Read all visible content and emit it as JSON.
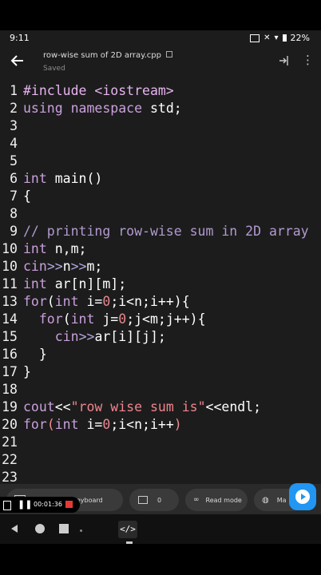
{
  "status": {
    "time": "9:11",
    "battery": "22%"
  },
  "appbar": {
    "file_name": "row-wise sum of 2D array.cpp",
    "save_state": "Saved"
  },
  "code_lines": [
    {
      "n": "1",
      "tokens": [
        [
          "kw2",
          "#include <iostream>"
        ]
      ]
    },
    {
      "n": "2",
      "tokens": [
        [
          "kw",
          "using namespace"
        ],
        [
          "plain",
          " std;"
        ]
      ]
    },
    {
      "n": "3",
      "tokens": []
    },
    {
      "n": "4",
      "tokens": []
    },
    {
      "n": "5",
      "tokens": []
    },
    {
      "n": "6",
      "tokens": [
        [
          "kw",
          "int"
        ],
        [
          "plain",
          " main()"
        ]
      ]
    },
    {
      "n": "7",
      "tokens": [
        [
          "plain",
          "{"
        ]
      ]
    },
    {
      "n": "8",
      "tokens": []
    },
    {
      "n": "9",
      "tokens": [
        [
          "cmt",
          "// printing row-wise sum in 2D array"
        ]
      ]
    },
    {
      "n": "10",
      "tokens": [
        [
          "kw",
          "int"
        ],
        [
          "plain",
          " n,m;"
        ]
      ]
    },
    {
      "n": "10",
      "tokens": [
        [
          "kw",
          "cin"
        ],
        [
          "op",
          ">>"
        ],
        [
          "plain",
          "n"
        ],
        [
          "op",
          ">>"
        ],
        [
          "plain",
          "m;"
        ]
      ]
    },
    {
      "n": "11",
      "tokens": [
        [
          "kw",
          "int"
        ],
        [
          "plain",
          " ar[n][m];"
        ]
      ]
    },
    {
      "n": "13",
      "tokens": [
        [
          "kw",
          "for"
        ],
        [
          "plain",
          "("
        ],
        [
          "kw",
          "int"
        ],
        [
          "plain",
          " i="
        ],
        [
          "num",
          "0"
        ],
        [
          "plain",
          ";i<n;i++){"
        ]
      ]
    },
    {
      "n": "14",
      "tokens": [
        [
          "plain",
          "  "
        ],
        [
          "kw",
          "for"
        ],
        [
          "plain",
          "("
        ],
        [
          "kw",
          "int"
        ],
        [
          "plain",
          " j="
        ],
        [
          "num",
          "0"
        ],
        [
          "plain",
          ";j<m;j++){"
        ]
      ]
    },
    {
      "n": "15",
      "tokens": [
        [
          "plain",
          "    "
        ],
        [
          "kw",
          "cin"
        ],
        [
          "op",
          ">>"
        ],
        [
          "plain",
          "ar[i][j];"
        ]
      ]
    },
    {
      "n": "16",
      "tokens": [
        [
          "plain",
          "  }"
        ]
      ]
    },
    {
      "n": "17",
      "tokens": [
        [
          "plain",
          "}"
        ]
      ]
    },
    {
      "n": "18",
      "tokens": []
    },
    {
      "n": "19",
      "tokens": [
        [
          "kw",
          "cout"
        ],
        [
          "plain",
          "<<"
        ],
        [
          "str",
          "\"row wise sum is\""
        ],
        [
          "plain",
          "<<endl;"
        ]
      ]
    },
    {
      "n": "20",
      "tokens": [
        [
          "kw",
          "for"
        ],
        [
          "bracket",
          "("
        ],
        [
          "kw",
          "int"
        ],
        [
          "plain",
          " i="
        ],
        [
          "num",
          "0"
        ],
        [
          "plain",
          ";i<n;i++"
        ],
        [
          "bracket",
          ")"
        ]
      ]
    },
    {
      "n": "21",
      "tokens": []
    },
    {
      "n": "22",
      "tokens": []
    },
    {
      "n": "23",
      "tokens": []
    }
  ],
  "toolbar": {
    "keyboard_label": "Try Reader's keyboard",
    "comments_count": "0",
    "read_mode_label": "Read mode",
    "more_label": "Ma"
  },
  "recorder": {
    "elapsed": "00:01:36"
  },
  "colors": {
    "background": "#1c1c1c",
    "accent": "#2196f3",
    "keyword": "#c9a0dc",
    "number": "#e5888f"
  }
}
